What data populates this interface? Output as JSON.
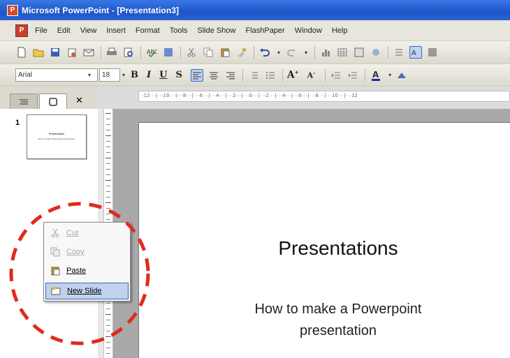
{
  "window": {
    "title": "Microsoft PowerPoint - [Presentation3]"
  },
  "menubar": {
    "items": [
      "File",
      "Edit",
      "View",
      "Insert",
      "Format",
      "Tools",
      "Slide Show",
      "FlashPaper",
      "Window",
      "Help"
    ]
  },
  "formatting": {
    "font": "Arial",
    "size": "18"
  },
  "panel": {
    "tab_outline": "outline-tab",
    "tab_slides": "slides-tab",
    "close": "✕",
    "slide_number": "1"
  },
  "thumbnail": {
    "title": "Presentation",
    "subtitle": "How to make a Powerpoint presentation"
  },
  "ruler": {
    "text": "·12···|···10···|···8···|···6···|···4···|···2···|···0···|···2···|···4···|···6···|···8···|···10···|···12"
  },
  "slide": {
    "title": "Presentations",
    "subtitle_line1": "How to make a Powerpoint",
    "subtitle_line2": "presentation"
  },
  "context_menu": {
    "items": [
      {
        "label": "Cut",
        "icon": "scissors-icon",
        "enabled": false
      },
      {
        "label": "Copy",
        "icon": "copy-icon",
        "enabled": false
      },
      {
        "label": "Paste",
        "icon": "paste-icon",
        "enabled": true
      },
      {
        "label": "New Slide",
        "icon": "new-slide-icon",
        "enabled": true,
        "highlighted": true
      }
    ]
  },
  "colors": {
    "titlebar": "#1e55c8",
    "annotation": "#e02a1e",
    "menu_highlight": "#c1d2ee"
  }
}
